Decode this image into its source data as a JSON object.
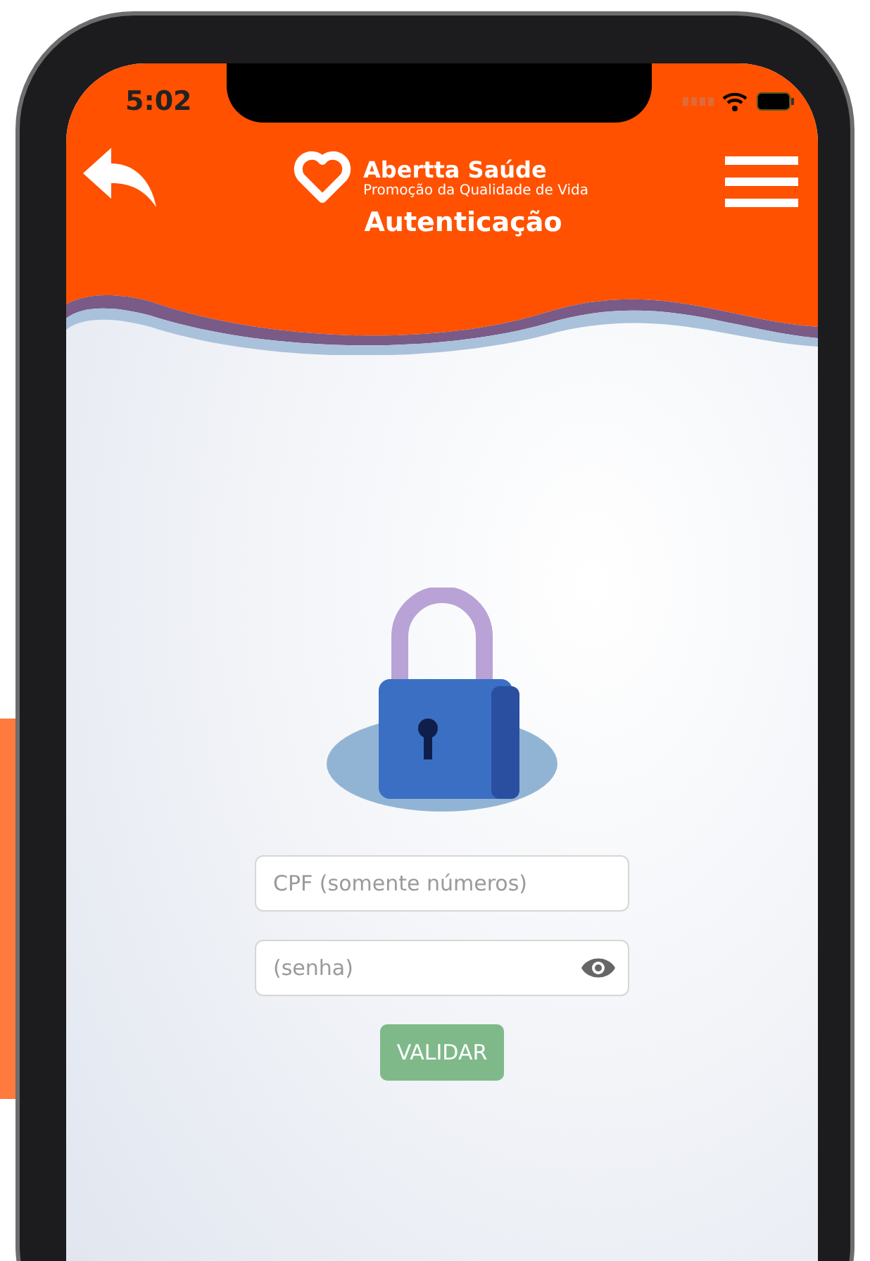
{
  "status_bar": {
    "time": "5:02"
  },
  "header": {
    "app_name": "Abertta Saúde",
    "tagline": "Promoção da Qualidade de Vida",
    "title": "Autenticação"
  },
  "form": {
    "cpf": {
      "placeholder": "CPF (somente números)"
    },
    "password": {
      "placeholder": "(senha)"
    },
    "submit": {
      "label": "VALIDAR",
      "disabled": true
    }
  }
}
